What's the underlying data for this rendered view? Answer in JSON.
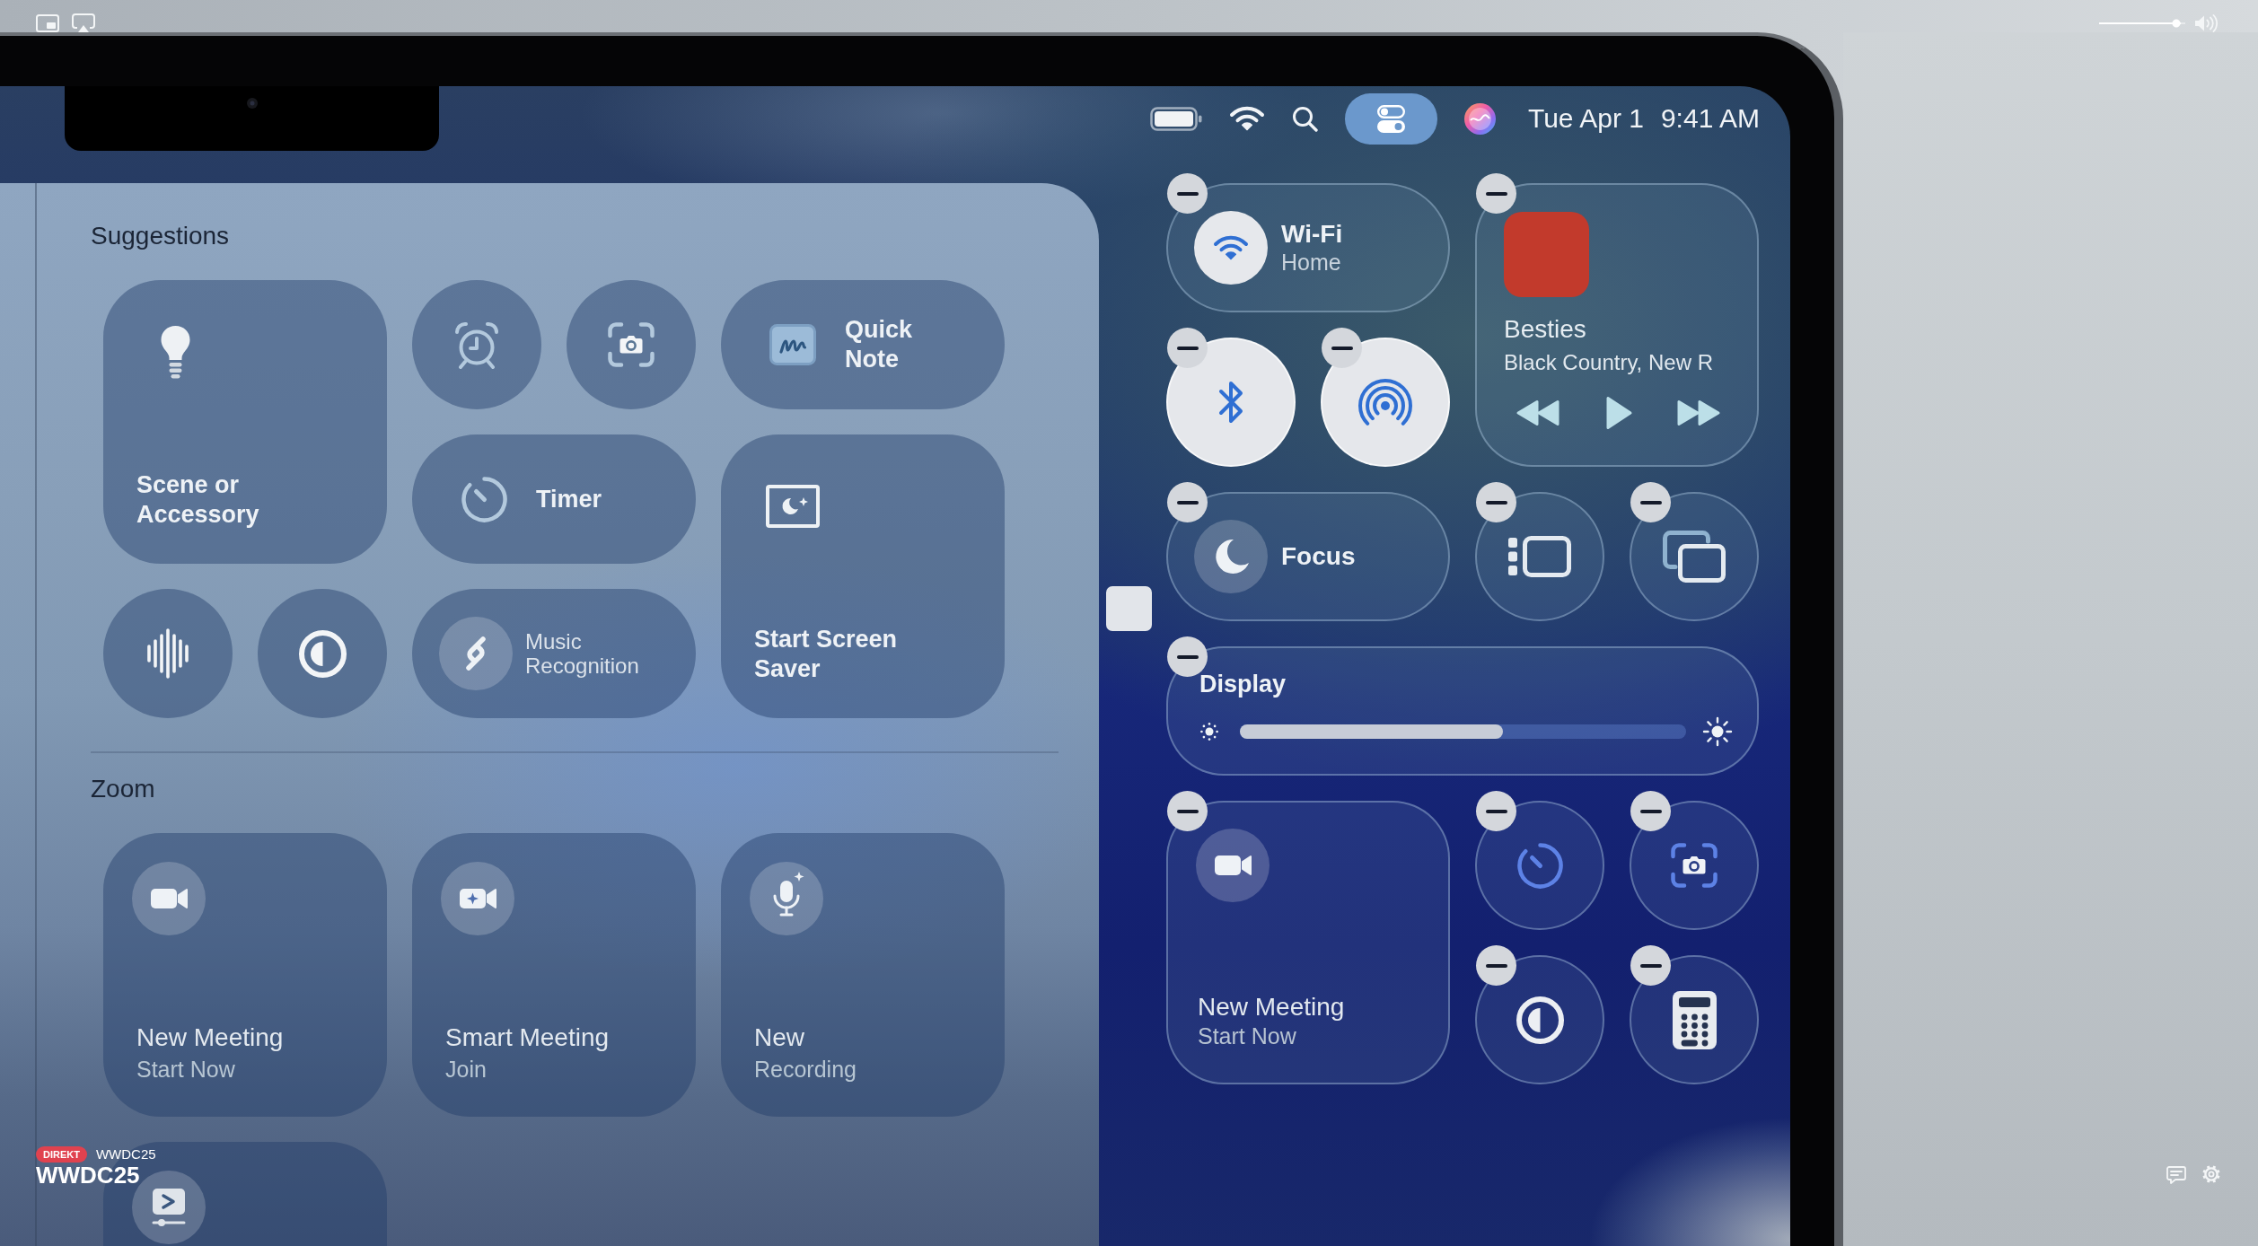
{
  "player": {
    "volume": {
      "level": 0.95
    }
  },
  "menu_bar": {
    "status_items": [
      {
        "selected": false
      },
      {
        "selected": false
      },
      {
        "selected": false
      },
      {
        "selected": true
      },
      {
        "selected": false
      }
    ],
    "date": "Tue Apr 1",
    "time": "9:41 AM"
  },
  "gallery": {
    "sections": [
      {
        "title": "Suggestions",
        "items": [
          {
            "kind": "tile",
            "title": "Scene or Accessory"
          },
          {
            "kind": "circle"
          },
          {
            "kind": "circle"
          },
          {
            "kind": "pill",
            "title": "Quick Note"
          },
          {
            "kind": "pill",
            "title": "Timer"
          },
          {
            "kind": "circle"
          },
          {
            "kind": "circle"
          },
          {
            "kind": "toggle",
            "title": "Music Recognition"
          },
          {
            "kind": "tile",
            "title": "Start Screen Saver"
          }
        ]
      },
      {
        "title": "Zoom",
        "items": [
          {
            "kind": "tile",
            "title": "New Meeting",
            "subtitle": "Start Now"
          },
          {
            "kind": "tile",
            "title": "Smart Meeting",
            "subtitle": "Join"
          },
          {
            "kind": "tile",
            "title": "New",
            "subtitle": "Recording"
          },
          {
            "kind": "tile"
          }
        ]
      }
    ]
  },
  "control_center": {
    "editing": true,
    "modules": [
      {
        "kind": "pill",
        "title": "Wi-Fi",
        "subtitle": "Home",
        "on": true
      },
      {
        "kind": "media",
        "title": "Besties",
        "subtitle": "Black Country, New R",
        "on": false
      },
      {
        "kind": "circle",
        "on": true
      },
      {
        "kind": "circle",
        "on": true
      },
      {
        "kind": "pill",
        "title": "Focus",
        "on": false
      },
      {
        "kind": "circle",
        "on": false
      },
      {
        "kind": "circle",
        "on": false
      },
      {
        "kind": "slider",
        "title": "Display",
        "level": 0.59,
        "on": false
      },
      {
        "kind": "tile",
        "title": "New Meeting",
        "subtitle": "Start Now",
        "on": false
      },
      {
        "kind": "circle",
        "on": false
      },
      {
        "kind": "circle",
        "on": false
      },
      {
        "kind": "circle",
        "on": false
      },
      {
        "kind": "circle",
        "on": false
      }
    ]
  },
  "broadcast": {
    "live_label": "DIREKT",
    "channel": "WWDC25",
    "title": "WWDC25"
  }
}
